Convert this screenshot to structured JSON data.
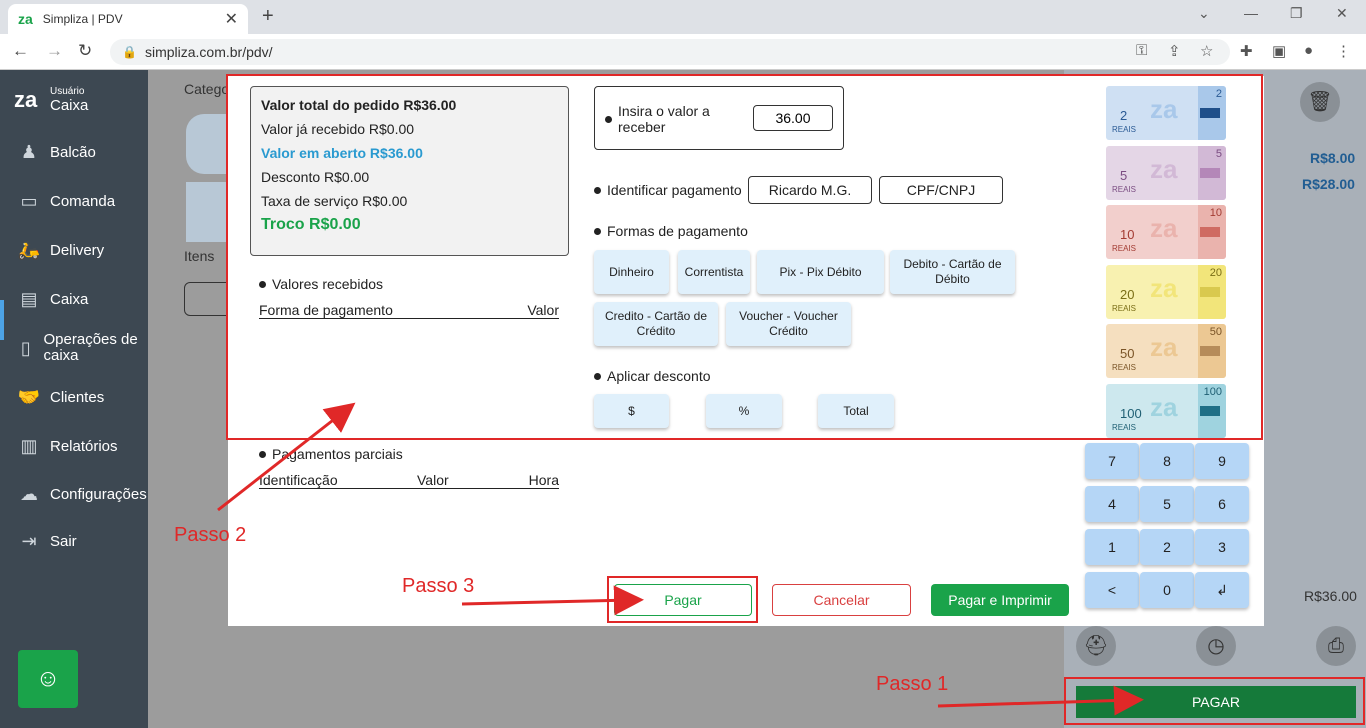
{
  "browser": {
    "tab_title": "Simpliza | PDV",
    "favicon_text": "za",
    "new_tab": "+",
    "url": "simpliza.com.br/pdv/"
  },
  "sidebar": {
    "logo": "za",
    "user_label": "Usuário",
    "user_name": "Caixa",
    "items": [
      {
        "label": "Balcão",
        "icon": "counter-icon"
      },
      {
        "label": "Comanda",
        "icon": "card-icon"
      },
      {
        "label": "Delivery",
        "icon": "scooter-icon"
      },
      {
        "label": "Caixa",
        "icon": "register-icon"
      },
      {
        "label": "Operações de caixa",
        "icon": "document-icon"
      },
      {
        "label": "Clientes",
        "icon": "handshake-icon"
      },
      {
        "label": "Relatórios",
        "icon": "chart-icon"
      },
      {
        "label": "Configurações",
        "icon": "cloud-gear-icon"
      },
      {
        "label": "Sair",
        "icon": "exit-icon"
      }
    ]
  },
  "background": {
    "categories_label": "Catego",
    "items_label": "Itens",
    "price1": "R$8.00",
    "price2": "R$28.00",
    "total": "R$36.00",
    "pagar_big": "PAGAR"
  },
  "summary": {
    "total": "Valor total do pedido R$36.00",
    "received": "Valor já recebido R$0.00",
    "open": "Valor em aberto R$36.00",
    "discount": "Desconto R$0.00",
    "service_fee": "Taxa de serviço R$0.00",
    "change": "Troco R$0.00"
  },
  "received_values": {
    "heading": "Valores recebidos",
    "col_method": "Forma de pagamento",
    "col_value": "Valor"
  },
  "partial_payments": {
    "heading": "Pagamentos parciais",
    "col_id": "Identificação",
    "col_value": "Valor",
    "col_time": "Hora"
  },
  "amount_input": {
    "label": "Insira o valor a receber",
    "value": "36.00"
  },
  "identify": {
    "label": "Identificar pagamento",
    "customer": "Ricardo M.G.",
    "doc": "CPF/CNPJ"
  },
  "payment_methods": {
    "heading": "Formas de pagamento",
    "options": [
      "Dinheiro",
      "Correntista",
      "Pix - Pix Débito",
      "Debito - Cartão de Débito",
      "Credito - Cartão de Crédito",
      "Voucher - Voucher Crédito"
    ]
  },
  "discount": {
    "heading": "Aplicar desconto",
    "options": [
      "$",
      "%",
      "Total"
    ]
  },
  "notes": [
    {
      "value": "2",
      "label": "REAIS",
      "bg": "#cfe0f3",
      "strip": "#a9c8ea",
      "sq": "#1f4f8a",
      "ink": "#2a5a94"
    },
    {
      "value": "5",
      "label": "REAIS",
      "bg": "#e4d6e6",
      "strip": "#d2b9d6",
      "sq": "#b487b8",
      "ink": "#7b4d82"
    },
    {
      "value": "10",
      "label": "REAIS",
      "bg": "#f2cfcc",
      "strip": "#eab3ad",
      "sq": "#cf6b62",
      "ink": "#a33c33"
    },
    {
      "value": "20",
      "label": "REAIS",
      "bg": "#f8f1b0",
      "strip": "#f2e57a",
      "sq": "#d9c94e",
      "ink": "#7a6e16"
    },
    {
      "value": "50",
      "label": "REAIS",
      "bg": "#f5dfbf",
      "strip": "#ecc893",
      "sq": "#b68c5a",
      "ink": "#7a5427"
    },
    {
      "value": "100",
      "label": "REAIS",
      "bg": "#cde8ee",
      "strip": "#9fd3df",
      "sq": "#1f6f86",
      "ink": "#1f5f73"
    }
  ],
  "keypad": [
    "7",
    "8",
    "9",
    "4",
    "5",
    "6",
    "1",
    "2",
    "3",
    "<",
    "0",
    "↲"
  ],
  "footer": {
    "pagar": "Pagar",
    "cancelar": "Cancelar",
    "pagar_imprimir": "Pagar e Imprimir"
  },
  "annotations": {
    "step1": "Passo 1",
    "step2": "Passo 2",
    "step3": "Passo 3"
  },
  "colors": {
    "accent_green": "#1aa34a",
    "highlight_red": "#e02828",
    "sidebar": "#3d4852"
  }
}
